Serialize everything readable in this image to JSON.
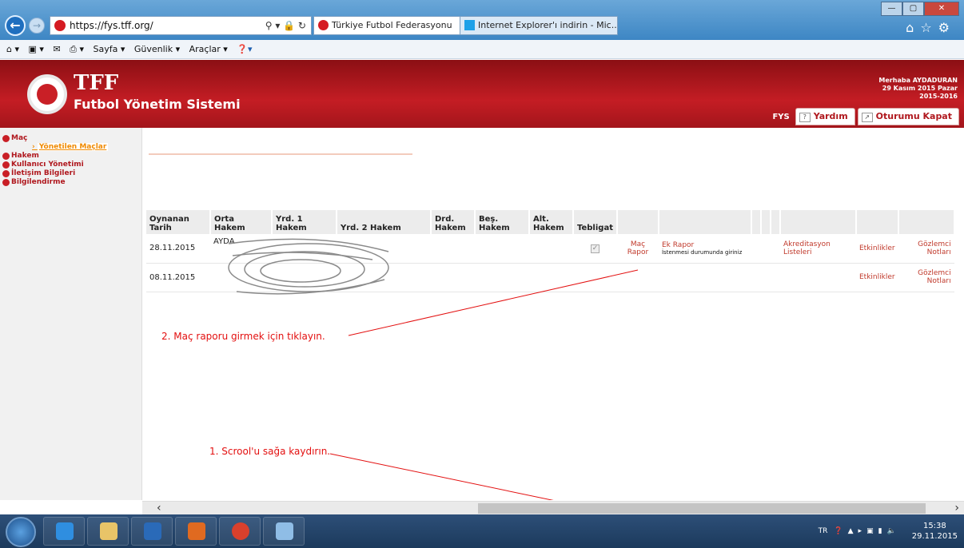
{
  "browser": {
    "address": "https://fys.tff.org/",
    "tabs": [
      {
        "label": "Türkiye Futbol Federasyonu"
      },
      {
        "label": "Internet Explorer'ı indirin - Mic..."
      }
    ],
    "command_bar": [
      "Sayfa ▾",
      "Güvenlik ▾",
      "Araçlar ▾"
    ]
  },
  "header": {
    "logo_text": "TFF",
    "subtitle": "Futbol Yönetim Sistemi",
    "greeting": "Merhaba AYDADURAN",
    "date": "29 Kasım 2015 Pazar",
    "season": "2015-2016",
    "nav": {
      "fys": "FYS",
      "help": "Yardım",
      "logout": "Oturumu Kapat"
    }
  },
  "sidebar": {
    "items": [
      "Maç",
      "Hakem",
      "Kullanıcı Yönetimi",
      "İletişim Bilgileri",
      "Bilgilendirme"
    ],
    "sub_item": "Yönetilen Maçlar"
  },
  "table": {
    "headers": [
      "Oynanan Tarih",
      "Orta Hakem",
      "Yrd. 1 Hakem",
      "Yrd. 2 Hakem",
      "Drd. Hakem",
      "Beş. Hakem",
      "Alt. Hakem",
      "Tebligat"
    ],
    "rows": [
      {
        "date": "28.11.2015",
        "ref": "AYDA",
        "checked": true,
        "mac_rapor": "Maç Rapor",
        "ek_rapor": "Ek Rapor",
        "ek_desc": "İstenmesi durumunda giriniz",
        "akreditasyon": "Akreditasyon Listeleri",
        "etkinlik": "Etkinlikler",
        "gozlemci": "Gözlemci Notları"
      },
      {
        "date": "08.11.2015",
        "etkinlik": "Etkinlikler",
        "gozlemci": "Gözlemci Notları"
      }
    ]
  },
  "annotations": {
    "step2": "2. Maç raporu girmek için tıklayın.",
    "step1": "1. Scrool'u sağa kaydırın."
  },
  "taskbar": {
    "lang": "TR",
    "time": "15:38",
    "date": "29.11.2015"
  },
  "colors": {
    "brand_red": "#c41d24",
    "link_red": "#c0392b",
    "annotation_red": "#e31010"
  }
}
